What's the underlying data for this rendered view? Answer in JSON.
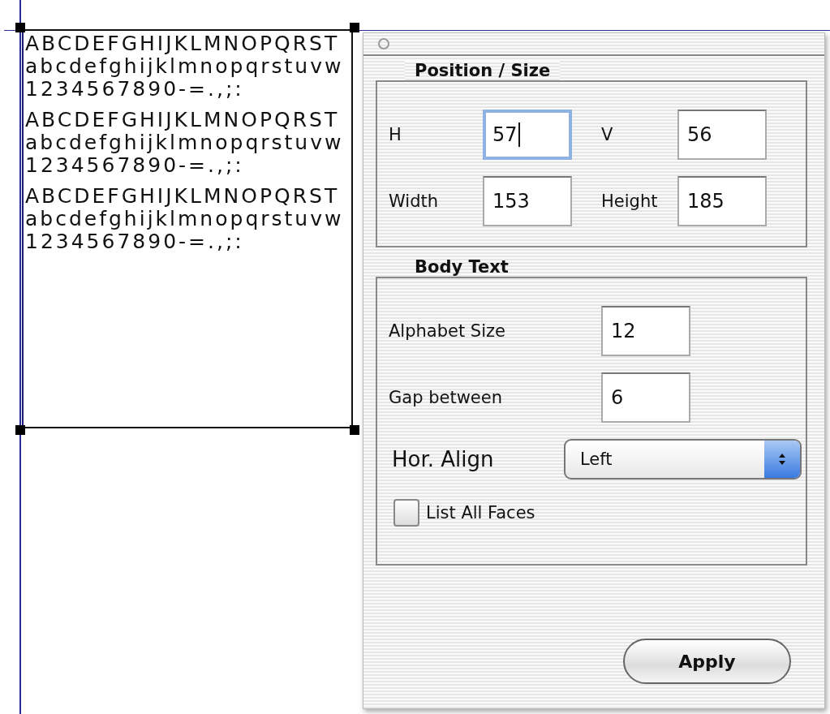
{
  "canvas": {
    "text_frame": {
      "selected": true,
      "paragraphs": [
        {
          "lines": [
            "ABCDEFGHIJKLMNOPQRST",
            "abcdefghijklmnopqrstuvw",
            "1234567890-=.,;:"
          ]
        },
        {
          "lines": [
            "ABCDEFGHIJKLMNOPQRST",
            "abcdefghijklmnopqrstuvw",
            "1234567890-=.,;:"
          ]
        },
        {
          "lines": [
            "ABCDEFGHIJKLMNOPQRST",
            "abcdefghijklmnopqrstuvw",
            "1234567890-=.,;:"
          ]
        }
      ]
    }
  },
  "panel": {
    "groups": [
      {
        "title": "Position / Size",
        "rows": [
          {
            "kind": "pair",
            "fields": [
              {
                "label": "H",
                "value": "57",
                "focused": true
              },
              {
                "label": "V",
                "value": "56",
                "focused": false
              }
            ]
          },
          {
            "kind": "pair",
            "fields": [
              {
                "label": "Width",
                "value": "153",
                "focused": false
              },
              {
                "label": "Height",
                "value": "185",
                "focused": false
              }
            ]
          }
        ]
      },
      {
        "title": "Body Text",
        "rows": [
          {
            "kind": "field",
            "label": "Alphabet Size",
            "value": "12",
            "focused": false
          },
          {
            "kind": "field",
            "label": "Gap between",
            "value": "6",
            "focused": false
          },
          {
            "kind": "popup",
            "label": "Hor. Align",
            "value": "Left"
          },
          {
            "kind": "checkbox",
            "label": "List All Faces",
            "checked": false
          }
        ]
      }
    ],
    "apply_button": "Apply"
  }
}
